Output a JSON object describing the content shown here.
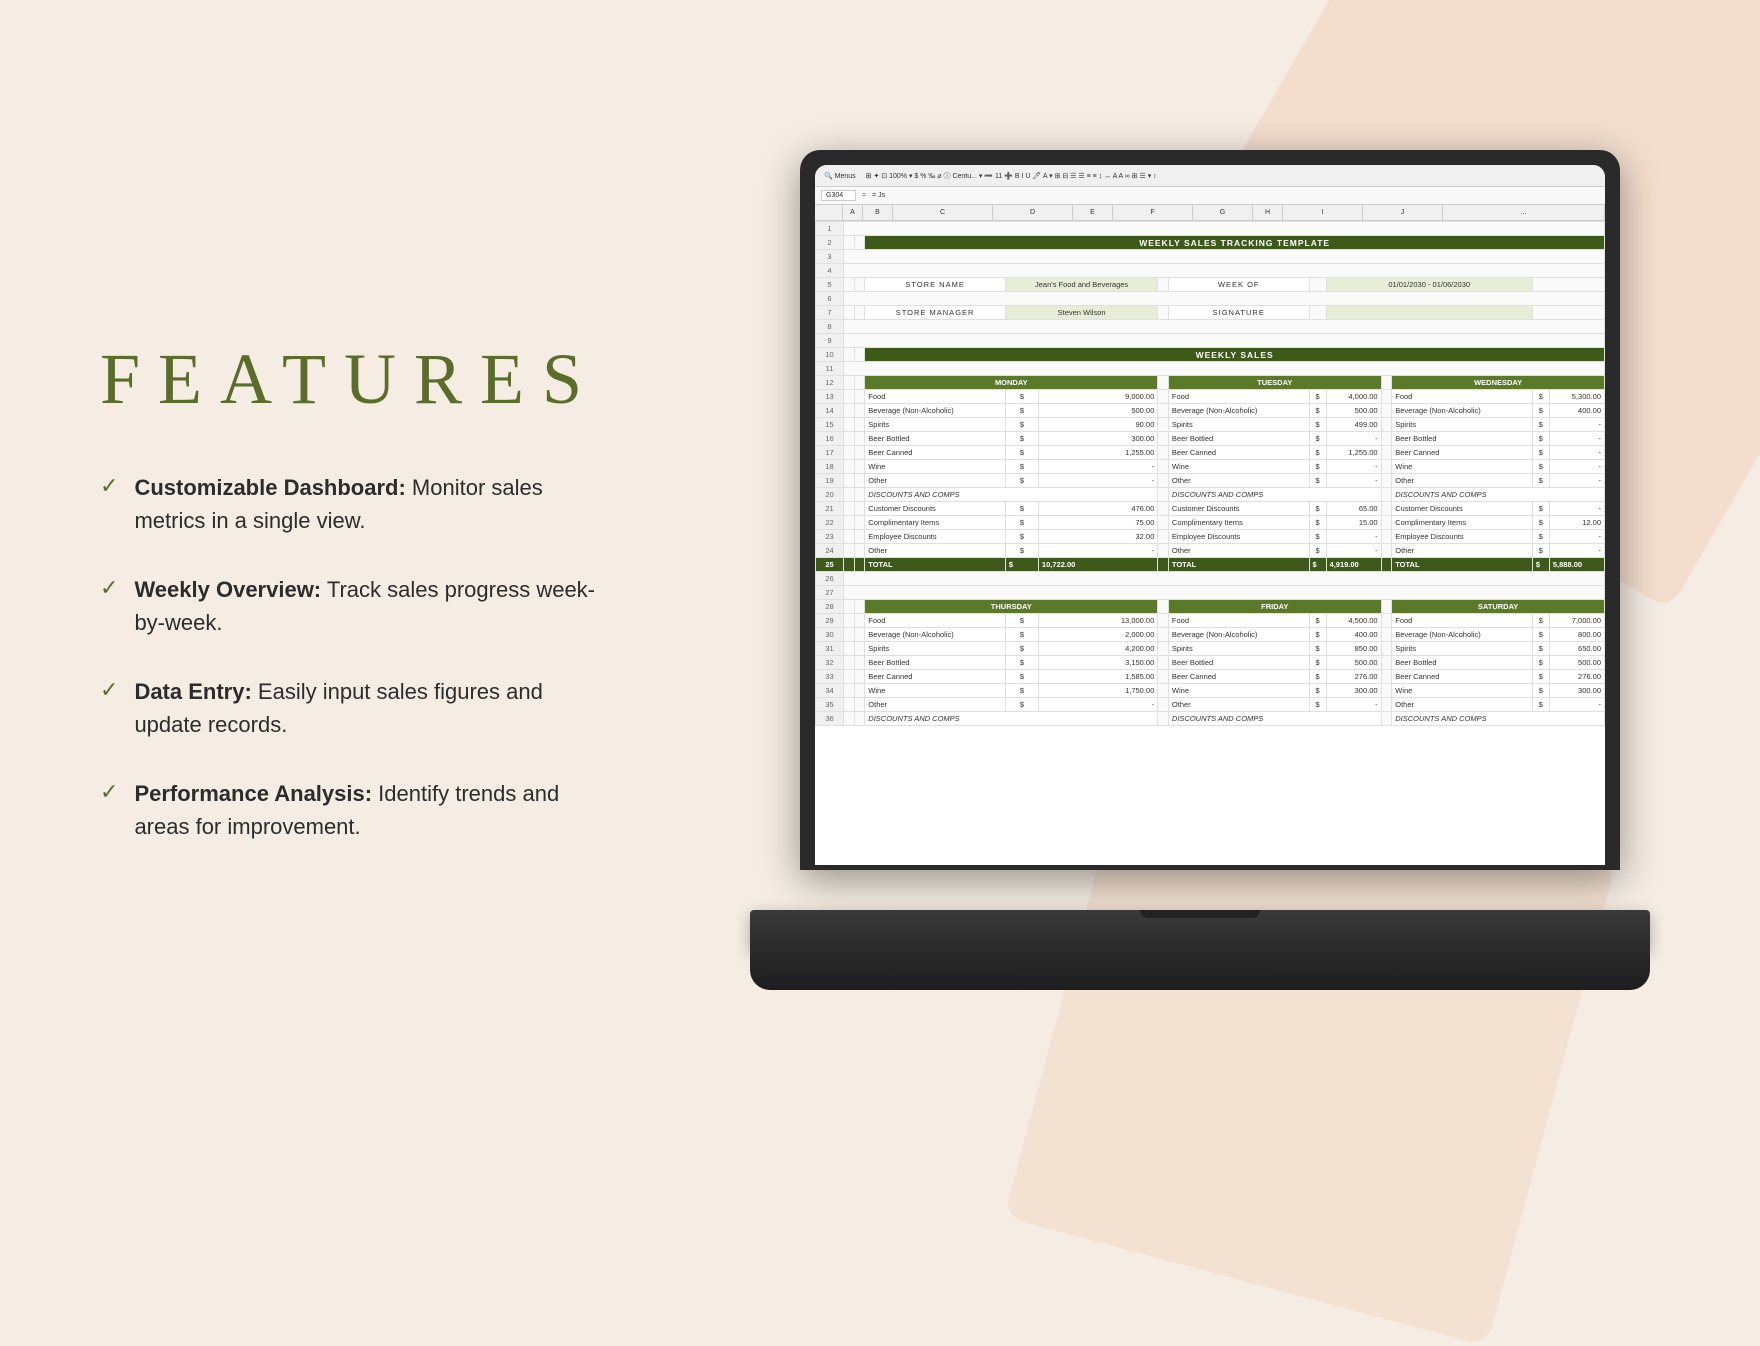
{
  "page": {
    "title": "Features",
    "background_color": "#f5ede4"
  },
  "left_panel": {
    "heading": "FEATURES",
    "features": [
      {
        "id": 1,
        "bold": "Customizable Dashboard:",
        "text": " Monitor sales metrics in a single view."
      },
      {
        "id": 2,
        "bold": "Weekly Overview:",
        "text": " Track sales progress week-by-week."
      },
      {
        "id": 3,
        "bold": "Data Entry:",
        "text": " Easily input sales figures and update records."
      },
      {
        "id": 4,
        "bold": "Performance Analysis:",
        "text": " Identify trends and areas for improvement."
      }
    ]
  },
  "spreadsheet": {
    "toolbar": {
      "cell_ref": "G304",
      "formula": "= Js"
    },
    "main_title": "WEEKLY SALES TRACKING TEMPLATE",
    "store_name_label": "STORE NAME",
    "store_name_value": "Jean's Food and Beverages",
    "week_of_label": "WEEK OF",
    "week_of_value": "01/01/2030 - 01/06/2030",
    "manager_label": "STORE MANAGER",
    "manager_value": "Steven Wilson",
    "signature_label": "SIGNATURE",
    "weekly_sales_title": "WEEKLY SALES",
    "days": [
      "MONDAY",
      "TUESDAY",
      "WEDNESDAY",
      "THURSDAY",
      "FRIDAY",
      "SATURDAY"
    ],
    "categories": [
      "Food",
      "Beverage (Non-Alcoholic)",
      "Spirits",
      "Beer Bottled",
      "Beer Canned",
      "Wine",
      "Other"
    ],
    "discounts_label": "DISCOUNTS AND COMPS",
    "discount_types": [
      "Customer Discounts",
      "Complimentary Items",
      "Employee Discounts",
      "Other"
    ],
    "monday_data": {
      "food": "9,000.00",
      "beverage": "500.00",
      "spirits": "90.00",
      "beer_bottled": "300.00",
      "beer_canned": "1,255.00",
      "wine": "-",
      "other": "-",
      "customer_discounts": "476.00",
      "complimentary": "75.00",
      "employee": "32.00",
      "other_disc": "-",
      "total": "10,722.00"
    },
    "tuesday_data": {
      "food": "4,000.00",
      "beverage": "500.00",
      "spirits": "499.00",
      "beer_bottled": "-",
      "beer_canned": "1,255.00",
      "wine": "-",
      "other": "-",
      "customer_discounts": "65.00",
      "complimentary": "15.00",
      "employee": "-",
      "other_disc": "-",
      "total": "4,919.00"
    },
    "wednesday_data": {
      "food": "5,300.00",
      "beverage": "400.00",
      "spirits": "-",
      "beer_bottled": "-",
      "beer_canned": "-",
      "wine": "-",
      "other": "-",
      "customer_discounts": "-",
      "complimentary": "12.00",
      "employee": "-",
      "other_disc": "-",
      "total": "5,888.00"
    },
    "thursday_data": {
      "food": "13,000.00",
      "beverage": "2,000.00",
      "spirits": "4,200.00",
      "beer_bottled": "3,150.00",
      "beer_canned": "1,585.00",
      "wine": "1,750.00",
      "other": "-"
    },
    "friday_data": {
      "food": "4,500.00",
      "beverage": "400.00",
      "spirits": "850.00",
      "beer_bottled": "500.00",
      "beer_canned": "276.00",
      "wine": "300.00",
      "other": "-"
    },
    "saturday_data": {
      "food": "7,000.00",
      "beverage": "800.00",
      "spirits": "650.00",
      "beer_bottled": "500.00",
      "beer_canned": "276.00",
      "wine": "300.00",
      "other": "-"
    }
  }
}
